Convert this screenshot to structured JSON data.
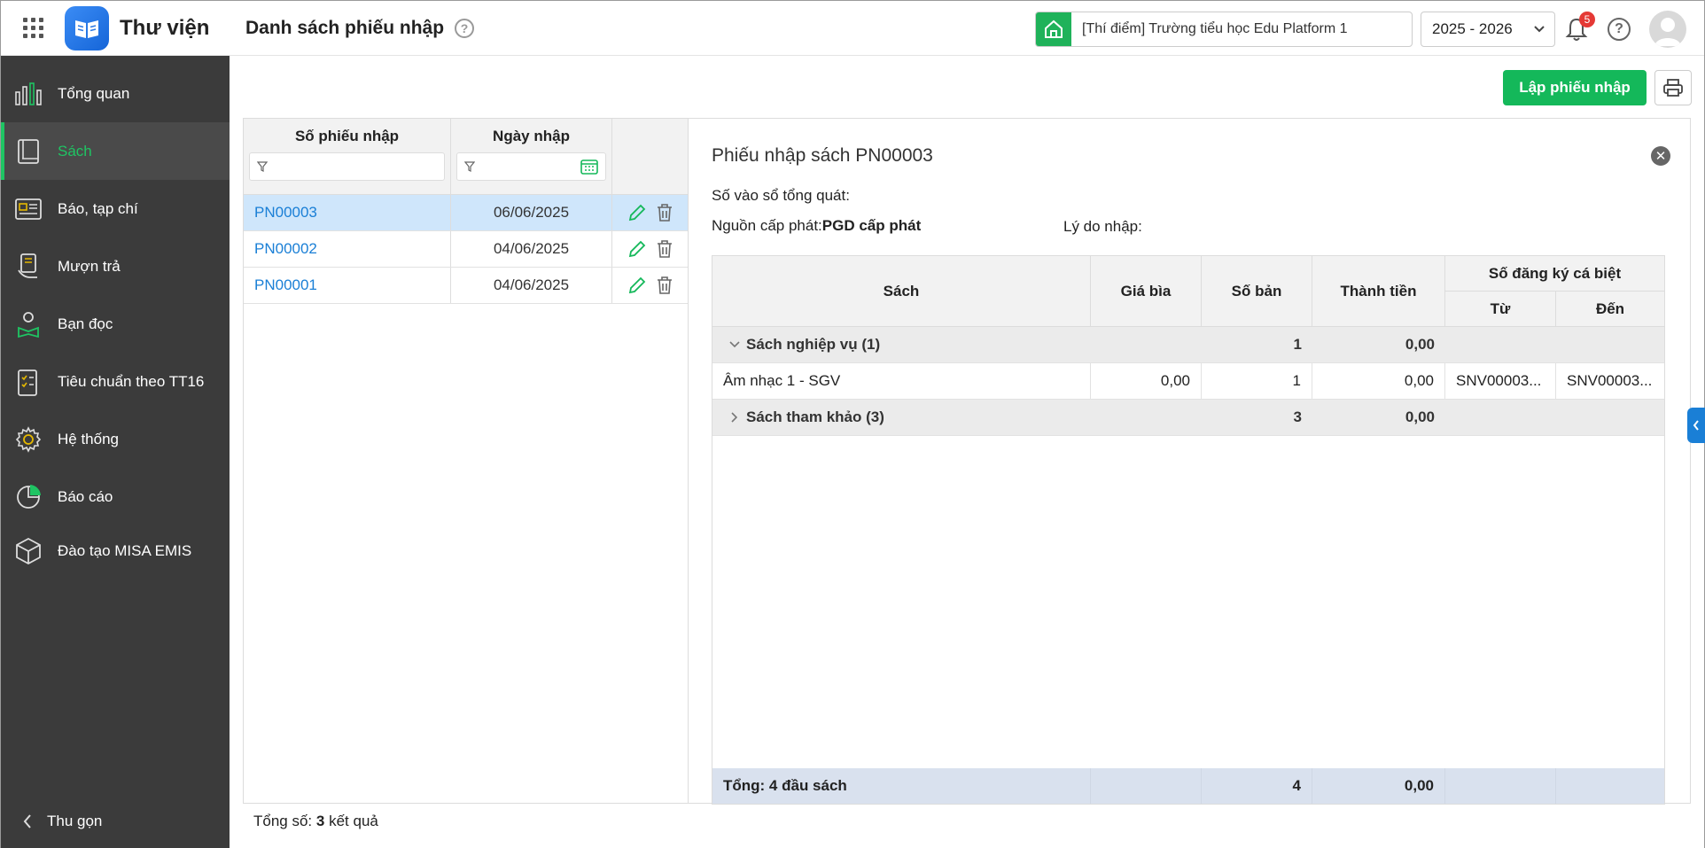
{
  "app": {
    "title": "Thư viện",
    "page_title": "Danh sách phiếu nhập"
  },
  "header": {
    "school": "[Thí điểm] Trường tiểu học Edu Platform 1",
    "year": "2025 - 2026",
    "notification_count": "5"
  },
  "sidebar": {
    "items": [
      {
        "label": "Tổng quan",
        "icon": "chart-bars-icon"
      },
      {
        "label": "Sách",
        "icon": "book-icon"
      },
      {
        "label": "Báo, tạp chí",
        "icon": "newspaper-icon"
      },
      {
        "label": "Mượn trả",
        "icon": "borrow-icon"
      },
      {
        "label": "Bạn đọc",
        "icon": "reader-icon"
      },
      {
        "label": "Tiêu chuẩn theo TT16",
        "icon": "checklist-icon"
      },
      {
        "label": "Hệ thống",
        "icon": "gear-icon"
      },
      {
        "label": "Báo cáo",
        "icon": "pie-chart-icon"
      },
      {
        "label": "Đào tạo MISA EMIS",
        "icon": "cube-icon"
      }
    ],
    "collapse_label": "Thu gọn"
  },
  "toolbar": {
    "create_label": "Lập phiếu nhập"
  },
  "list": {
    "col_number": "Số phiếu nhập",
    "col_date": "Ngày nhập",
    "rows": [
      {
        "number": "PN00003",
        "date": "06/06/2025"
      },
      {
        "number": "PN00002",
        "date": "04/06/2025"
      },
      {
        "number": "PN00001",
        "date": "04/06/2025"
      }
    ],
    "footer_prefix": "Tổng số:",
    "footer_count": "3",
    "footer_suffix": "kết quả"
  },
  "detail": {
    "title": "Phiếu nhập sách PN00003",
    "general_label": "Số vào sổ tổng quát:",
    "source_label": "Nguồn cấp phát:",
    "source_value": "PGD cấp phát",
    "reason_label": "Lý do nhập:",
    "table": {
      "col_book": "Sách",
      "col_price": "Giá bìa",
      "col_qty": "Số bản",
      "col_amount": "Thành tiền",
      "col_reg": "Số đăng ký cá biệt",
      "col_from": "Từ",
      "col_to": "Đến",
      "group1": {
        "name": "Sách nghiệp vụ (1)",
        "qty": "1",
        "amount": "0,00"
      },
      "row1": {
        "book": "Âm nhạc 1 - SGV",
        "price": "0,00",
        "qty": "1",
        "amount": "0,00",
        "from": "SNV00003...",
        "to": "SNV00003..."
      },
      "group2": {
        "name": "Sách tham khảo (3)",
        "qty": "3",
        "amount": "0,00"
      },
      "footer": {
        "label": "Tổng: 4 đầu sách",
        "qty": "4",
        "amount": "0,00"
      }
    }
  },
  "colors": {
    "accent": "#14b85a",
    "link": "#1a7fd6",
    "sidebar": "#3b3b3b"
  }
}
